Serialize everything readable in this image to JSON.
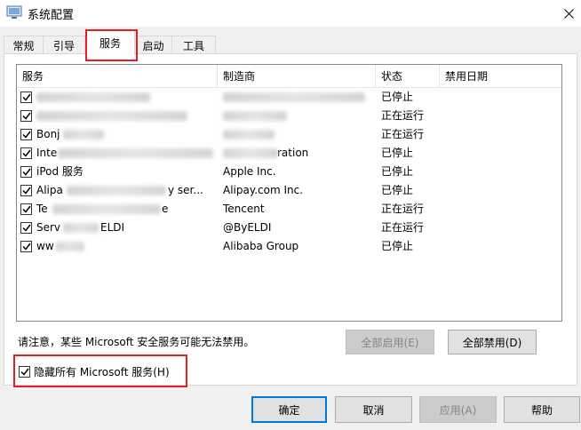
{
  "window": {
    "title": "系统配置",
    "close_glyph": "✕"
  },
  "tabs": [
    {
      "label": "常规"
    },
    {
      "label": "引导"
    },
    {
      "label": "服务"
    },
    {
      "label": "启动"
    },
    {
      "label": "工具"
    }
  ],
  "services": {
    "columns": [
      "服务",
      "制造商",
      "状态",
      "禁用日期"
    ],
    "rows": [
      {
        "checked": true,
        "name": "",
        "manufacturer": "",
        "status": "已停止"
      },
      {
        "checked": true,
        "name": "",
        "manufacturer": "",
        "status": "正在运行"
      },
      {
        "checked": true,
        "name": "Bonj",
        "manufacturer": "",
        "status": "正在运行"
      },
      {
        "checked": true,
        "name": "Inte",
        "manufacturer": "ration",
        "status": "已停止"
      },
      {
        "checked": true,
        "name": "iPod 服务",
        "manufacturer": "Apple Inc.",
        "status": "已停止"
      },
      {
        "checked": true,
        "name": "Alipa",
        "name_tail": "y ser...",
        "manufacturer": "Alipay.com Inc.",
        "status": "已停止"
      },
      {
        "checked": true,
        "name": "Te",
        "name_tail": "e",
        "manufacturer": "Tencent",
        "status": "正在运行"
      },
      {
        "checked": true,
        "name": "Serv",
        "name_tail": "ELDI",
        "manufacturer": "@ByELDI",
        "status": "正在运行"
      },
      {
        "checked": true,
        "name": "ww",
        "manufacturer": "Alibaba Group",
        "status": "已停止"
      }
    ]
  },
  "note": "请注意，某些 Microsoft 安全服务可能无法禁用。",
  "buttons": {
    "enable_all": "全部启用(E)",
    "disable_all": "全部禁用(D)",
    "ok": "确定",
    "cancel": "取消",
    "apply": "应用(A)",
    "help": "帮助"
  },
  "hide_ms": {
    "checked": true,
    "label": "隐藏所有 Microsoft 服务(H)"
  },
  "colors": {
    "highlight": "#e21f26",
    "default_button": "#0078d7"
  }
}
